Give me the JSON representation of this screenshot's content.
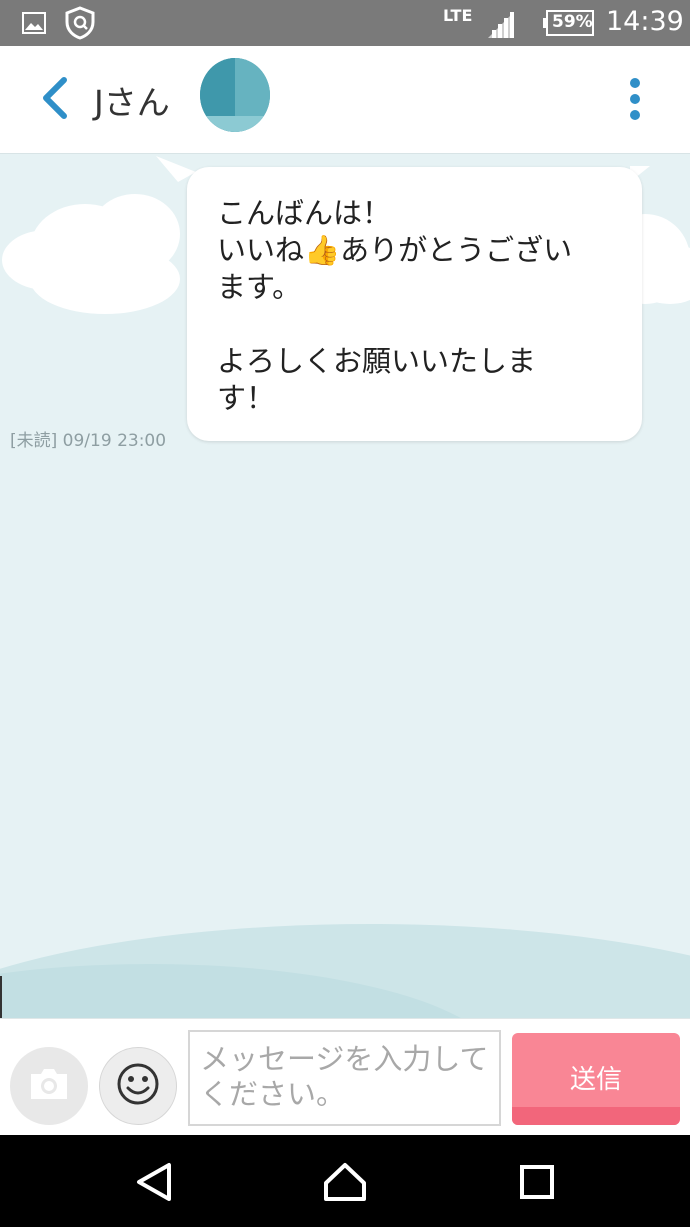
{
  "status_bar": {
    "network": "LTE",
    "battery": "59%",
    "time": "14:39",
    "icons": [
      "image-icon",
      "shield-icon",
      "signal-icon",
      "battery-icon"
    ]
  },
  "header": {
    "contact_name": "Jさん",
    "icons": [
      "back-chevron-icon",
      "avatar",
      "more-vert-icon"
    ],
    "accent_color": "#2f8fc8"
  },
  "chat": {
    "messages": [
      {
        "text": "こんばんは！\nいいね👍ありがとうござい\nます。\n\nよろしくお願いいたしま\nす！",
        "read_status": "[未読]",
        "timestamp": "09/19 23:00"
      }
    ]
  },
  "composer": {
    "placeholder": "メッセージを入力してください。",
    "send_label": "送信",
    "send_color": "#f98695",
    "icons": [
      "camera-icon",
      "emoji-icon"
    ]
  },
  "nav_bar": {
    "icons": [
      "back-triangle-icon",
      "home-icon",
      "recents-icon"
    ]
  }
}
